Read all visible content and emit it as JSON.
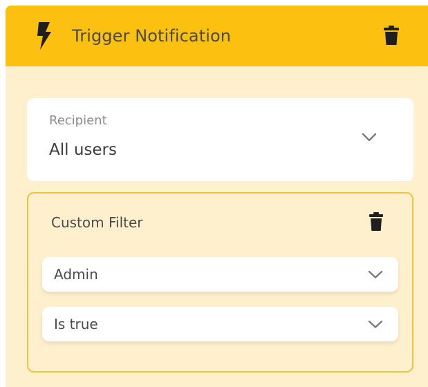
{
  "colors": {
    "header_bg": "#fcc011",
    "panel_bg": "#fff0cd",
    "filter_border": "#f4c041",
    "text_dark": "#4a4a4a",
    "text_muted": "#8a8a8a"
  },
  "header": {
    "icon": "lightning-bolt-icon",
    "title": "Trigger Notification",
    "delete_icon": "trash-icon"
  },
  "recipient": {
    "label": "Recipient",
    "value": "All users",
    "dropdown_icon": "chevron-down-icon"
  },
  "custom_filter": {
    "title": "Custom Filter",
    "delete_icon": "trash-icon",
    "selects": [
      {
        "value": "Admin",
        "dropdown_icon": "chevron-down-icon"
      },
      {
        "value": "Is true",
        "dropdown_icon": "chevron-down-icon"
      }
    ]
  }
}
